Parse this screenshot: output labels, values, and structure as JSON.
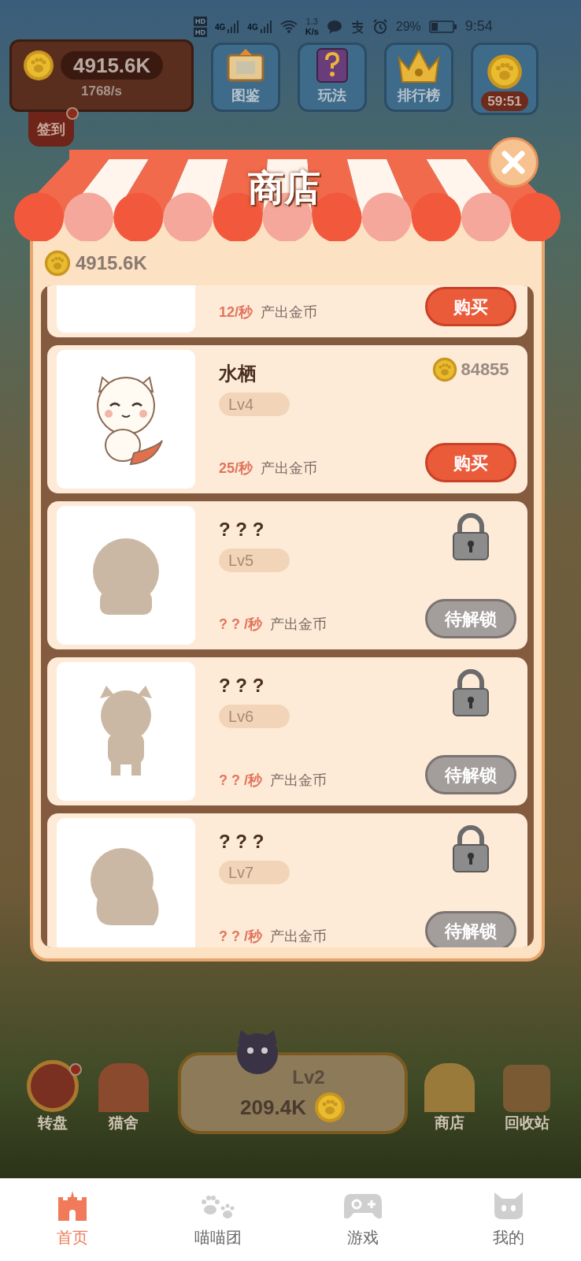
{
  "status_bar": {
    "hd_labels": [
      "HD",
      "HD"
    ],
    "networks": [
      "4G",
      "4G"
    ],
    "net_speed": [
      "1.3",
      "K/s"
    ],
    "battery": "29%",
    "time": "9:54"
  },
  "top": {
    "coins": "4915.6K",
    "rate": "1768/s",
    "sign_in": {
      "label": "签到",
      "badge": true
    },
    "buttons": [
      {
        "kind": "book",
        "label": "图鉴"
      },
      {
        "kind": "help",
        "label": "玩法"
      },
      {
        "kind": "crown",
        "label": "排行榜"
      }
    ],
    "timer": "59:51"
  },
  "shop": {
    "title": "商店",
    "balance": "4915.6K",
    "items": [
      {
        "kind": "available",
        "rate": "12/秒",
        "rate_label": "产出金币",
        "button": "购买"
      },
      {
        "kind": "available",
        "name": "水栖",
        "level": "Lv4",
        "price": "84855",
        "rate": "25/秒",
        "rate_label": "产出金币",
        "button": "购买"
      },
      {
        "kind": "locked",
        "name": "? ? ?",
        "level": "Lv5",
        "rate": "? ? /秒",
        "rate_label": "产出金币",
        "button": "待解锁"
      },
      {
        "kind": "locked",
        "name": "? ? ?",
        "level": "Lv6",
        "rate": "? ? /秒",
        "rate_label": "产出金币",
        "button": "待解锁"
      },
      {
        "kind": "locked",
        "name": "? ? ?",
        "level": "Lv7",
        "rate": "? ? /秒",
        "rate_label": "产出金币",
        "button": "待解锁"
      }
    ]
  },
  "bottom": {
    "left": [
      {
        "label": "转盘",
        "badge": true
      },
      {
        "label": "猫舍",
        "badge": false
      }
    ],
    "level": "Lv2",
    "cost": "209.4K",
    "right": [
      {
        "label": "商店"
      },
      {
        "label": "回收站"
      }
    ]
  },
  "nav": [
    {
      "label": "首页",
      "selected": true
    },
    {
      "label": "喵喵团",
      "selected": false
    },
    {
      "label": "游戏",
      "selected": false
    },
    {
      "label": "我的",
      "selected": false
    }
  ]
}
